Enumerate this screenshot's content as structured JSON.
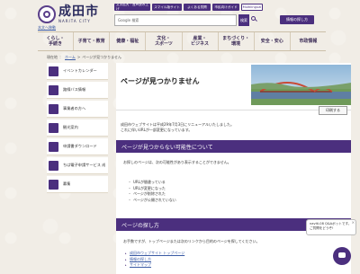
{
  "header": {
    "logo_text": "成田市",
    "logo_en": "NARITA CITY",
    "skip_link": "本文へ移動",
    "top_links": [
      "文字拡大・音声読み上げ",
      "スマイル版サイト",
      "よくある質問",
      "市民向けガイド",
      "Multilingual"
    ],
    "search_placeholder": "Google 検索",
    "search_button": "検索",
    "info_button": "情報の探し方"
  },
  "global_nav": [
    "くらし・\n手続き",
    "子育て・教育",
    "健康・福祉",
    "文化・\nスポーツ",
    "産業・\nビジネス",
    "まちづくり・\n環境",
    "安全・安心",
    "市政情報"
  ],
  "breadcrumb": {
    "prefix": "現在地",
    "home": "ホーム",
    "current": "ページが見つかりません"
  },
  "sidebar": [
    "イベントカレンダー",
    "路線バス情報",
    "事業者の方へ",
    "観光案内",
    "申請書ダウンロード",
    "ちば電子申請サービス 成",
    "募集"
  ],
  "main": {
    "title": "ページが見つかりません",
    "print_button": "印刷する",
    "intro_lines": [
      "成田市ウェブサイトは平成29年7月3日にリニューアルいたしました。",
      "これに伴いURLが一部変更になっています。"
    ],
    "section1_heading": "ページが見つからない可能性について",
    "section1_text": "お探しのページは、次の可能性があり表示することができません。",
    "reasons": [
      "URLが間違っている",
      "URLが変更になった",
      "ページが削除された",
      "ページが公開されていない"
    ],
    "section2_heading": "ページの探し方",
    "section2_text": "お手数ですが、トップページまたは次のリンクから目的のページを探してください。",
    "links": [
      "成田市ウェブサイト トップページ",
      "情報の探し方",
      "サイトマップ"
    ]
  },
  "chatbot": {
    "bubble_line1": "naviti-08 Q&Aボットです。",
    "bubble_line2": "ご質問をどうぞ!",
    "close": "×"
  },
  "colors": {
    "brand_purple": "#4b2f7e",
    "link_blue": "#3b5ba5",
    "background": "#f1ede6"
  },
  "icons": [
    "seal-logo-icon",
    "search-icon",
    "calendar-icon",
    "bus-icon",
    "business-icon",
    "tourism-icon",
    "download-icon",
    "online-form-icon",
    "recruit-icon",
    "print-icon",
    "chatbot-icon"
  ]
}
